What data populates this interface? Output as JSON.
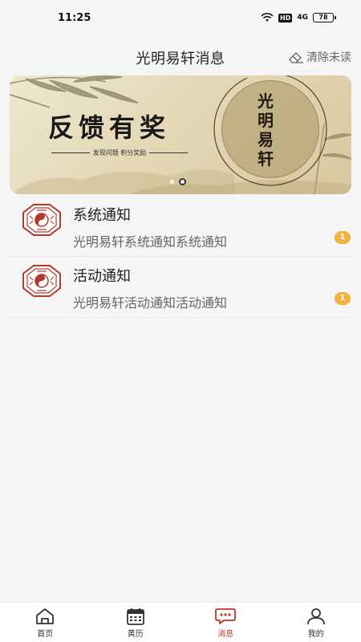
{
  "status_bar": {
    "time": "11:25",
    "hd": "HD",
    "signal": "4G",
    "battery": "78"
  },
  "header": {
    "title": "光明易轩消息",
    "clear_unread": "清除未读",
    "clear_icon": "eraser-icon"
  },
  "banner": {
    "title": "反馈有奖",
    "subtitle": "发现问题 积分奖励",
    "seal_text": "光明易轩",
    "colors": {
      "paper": "#e4d8b6",
      "ink": "#1a1a1a"
    },
    "pages": 2,
    "active_page": 2
  },
  "messages": [
    {
      "title": "系统通知",
      "preview": "光明易轩系统通知系统通知",
      "badge": "1",
      "icon": "bagua-icon"
    },
    {
      "title": "活动通知",
      "preview": "光明易轩活动通知活动通知",
      "badge": "1",
      "icon": "bagua-icon"
    }
  ],
  "bottom_nav": [
    {
      "label": "首页",
      "icon": "home-icon"
    },
    {
      "label": "黄历",
      "icon": "calendar-icon"
    },
    {
      "label": "消息",
      "icon": "message-icon",
      "active": true
    },
    {
      "label": "我的",
      "icon": "user-icon"
    }
  ],
  "colors": {
    "accent": "#c0392b",
    "badge": "#f2b340",
    "background": "#f5f5f5"
  }
}
